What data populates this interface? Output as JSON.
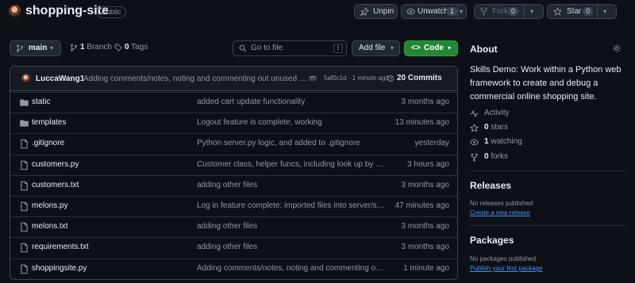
{
  "repo": {
    "name": "shopping-site",
    "visibility": "Public"
  },
  "actions": {
    "unpin_label": "Unpin",
    "watch_label": "Unwatch",
    "watch_count": "1",
    "fork_label": "Fork",
    "fork_count": "0",
    "star_label": "Star",
    "star_count": "0"
  },
  "toolbar": {
    "branch": "main",
    "branches_count": "1",
    "branches_label": "Branch",
    "tags_count": "0",
    "tags_label": "Tags",
    "search_placeholder": "Go to file",
    "search_shortcut": "t",
    "add_file_label": "Add file",
    "code_label": "Code"
  },
  "latest_commit": {
    "author": "LuccaWang1",
    "message": "Adding comments/notes, noting and commenting out unused code",
    "sha_time": "5af0c1d · 1 minute ago",
    "count": "20",
    "count_label": "Commits"
  },
  "files": [
    {
      "name": "static",
      "type": "dir",
      "message": "added cart update functionality",
      "date": "3 months ago"
    },
    {
      "name": "templates",
      "type": "dir",
      "message": "Logout feature is complete, working",
      "date": "13 minutes ago"
    },
    {
      "name": ".gitignore",
      "type": "file",
      "message": "Python server.py logic, and added to .gitignore",
      "date": "yesterday"
    },
    {
      "name": "customers.py",
      "type": "file",
      "message": "Customer class, helper funcs, including look up by email",
      "date": "3 hours ago"
    },
    {
      "name": "customers.txt",
      "type": "file",
      "message": "adding other files",
      "date": "3 months ago"
    },
    {
      "name": "melons.py",
      "type": "file",
      "message": "Log in feature complete: imported files into server/shopping-site",
      "date": "47 minutes ago"
    },
    {
      "name": "melons.txt",
      "type": "file",
      "message": "adding other files",
      "date": "3 months ago"
    },
    {
      "name": "requirements.txt",
      "type": "file",
      "message": "adding other files",
      "date": "3 months ago"
    },
    {
      "name": "shoppingsite.py",
      "type": "file",
      "message": "Adding comments/notes, noting and commenting out unused code",
      "date": "1 minute ago"
    }
  ],
  "about": {
    "heading": "About",
    "description": "Skills Demo: Work within a Python web framework to create and debug a commercial online shopping site.",
    "activity_label": "Activity",
    "stars_count": "0",
    "stars_label": "stars",
    "watching_count": "1",
    "watching_label": "watching",
    "forks_count": "0",
    "forks_label": "forks"
  },
  "releases": {
    "heading": "Releases",
    "empty_text": "No releases published",
    "link": "Create a new release"
  },
  "packages": {
    "heading": "Packages",
    "empty_text": "No packages published",
    "link": "Publish your first package"
  },
  "colors": {
    "accent_green": "#238636",
    "link_blue": "#4493f8",
    "bg": "#0d1117",
    "border": "#3d444d"
  }
}
